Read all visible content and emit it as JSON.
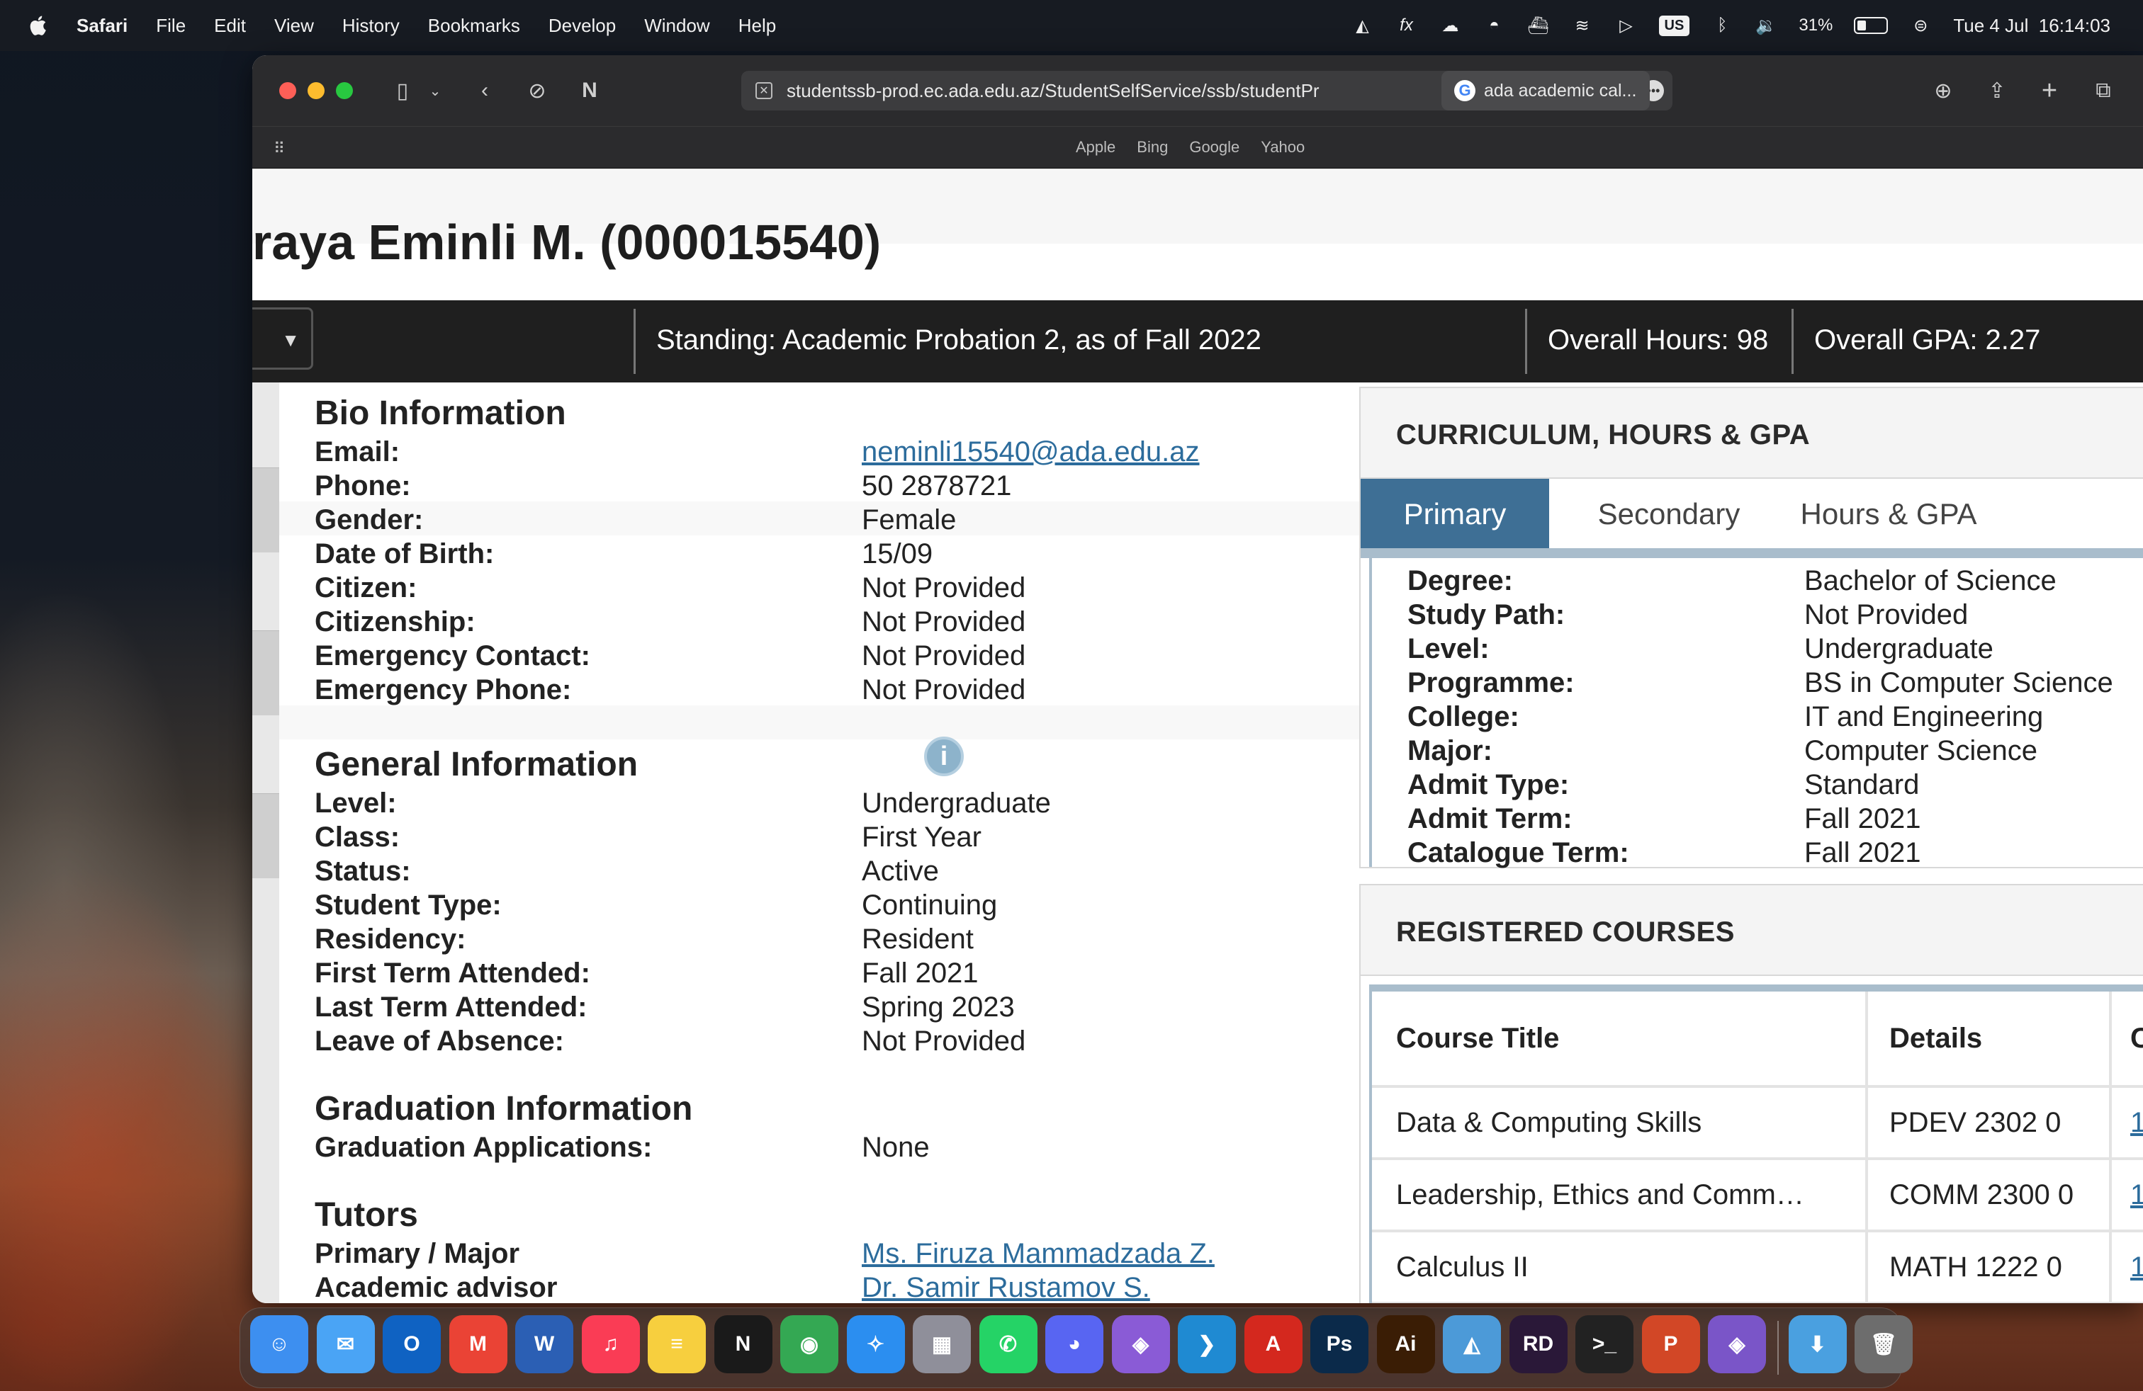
{
  "menubar": {
    "app_name": "Safari",
    "items": [
      "File",
      "Edit",
      "View",
      "History",
      "Bookmarks",
      "Develop",
      "Window",
      "Help"
    ],
    "battery_percent": "31%",
    "battery_level": 0.31,
    "input_source": "US",
    "clock": "Tue 4 Jul  16:14:03"
  },
  "browser": {
    "url": "studentssb-prod.ec.ada.edu.az/StudentSelfService/ssb/studentPr",
    "second_tab": "ada academic cal...",
    "favorites": [
      "Apple",
      "Bing",
      "Google",
      "Yahoo"
    ]
  },
  "profile": {
    "student_name": "raya Eminli M. (000015540)",
    "standing": "Standing: Academic Probation 2, as of Fall 2022",
    "overall_hours": "Overall Hours: 98",
    "overall_gpa": "Overall GPA: 2.27"
  },
  "bio": {
    "title": "Bio Information",
    "rows": [
      {
        "label": "Email:",
        "value": "neminli15540@ada.edu.az"
      },
      {
        "label": "Phone:",
        "value": "50 2878721"
      },
      {
        "label": "Gender:",
        "value": "Female"
      },
      {
        "label": "Date of Birth:",
        "value": "15/09"
      },
      {
        "label": "Citizen:",
        "value": "Not Provided"
      },
      {
        "label": "Citizenship:",
        "value": "Not Provided"
      },
      {
        "label": "Emergency Contact:",
        "value": "Not Provided"
      },
      {
        "label": "Emergency Phone:",
        "value": "Not Provided"
      }
    ]
  },
  "general": {
    "title": "General Information",
    "rows": [
      {
        "label": "Level:",
        "value": "Undergraduate"
      },
      {
        "label": "Class:",
        "value": "First Year"
      },
      {
        "label": "Status:",
        "value": "Active"
      },
      {
        "label": "Student Type:",
        "value": "Continuing"
      },
      {
        "label": "Residency:",
        "value": "Resident"
      },
      {
        "label": "First Term Attended:",
        "value": "Fall 2021"
      },
      {
        "label": "Last Term Attended:",
        "value": "Spring 2023"
      },
      {
        "label": "Leave of Absence:",
        "value": "Not Provided"
      }
    ]
  },
  "graduation": {
    "title": "Graduation Information",
    "rows": [
      {
        "label": "Graduation Applications:",
        "value": "None"
      }
    ]
  },
  "tutors": {
    "title": "Tutors",
    "rows": [
      {
        "label": "Primary / Major",
        "value": "Ms. Firuza Mammadzada Z."
      },
      {
        "label": "Academic advisor",
        "value": "Dr. Samir Rustamov S."
      }
    ]
  },
  "curriculum": {
    "title": "CURRICULUM, HOURS & GPA",
    "tabs": [
      "Primary",
      "Secondary",
      "Hours & GPA"
    ],
    "rows": [
      {
        "label": "Degree:",
        "value": "Bachelor of Science"
      },
      {
        "label": "Study Path:",
        "value": "Not Provided"
      },
      {
        "label": "Level:",
        "value": "Undergraduate"
      },
      {
        "label": "Programme:",
        "value": "BS in Computer Science"
      },
      {
        "label": "College:",
        "value": "IT and Engineering"
      },
      {
        "label": "Major:",
        "value": "Computer Science"
      },
      {
        "label": "Admit Type:",
        "value": "Standard"
      },
      {
        "label": "Admit Term:",
        "value": "Fall 2021"
      },
      {
        "label": "Catalogue Term:",
        "value": "Fall 2021"
      }
    ]
  },
  "courses": {
    "title": "REGISTERED COURSES",
    "headers": [
      "Course Title",
      "Details",
      "C"
    ],
    "rows": [
      {
        "title": "Data & Computing Skills",
        "details": "PDEV 2302 0",
        "c": "1("
      },
      {
        "title": "Leadership, Ethics and Comm…",
        "details": "COMM 2300 0",
        "c": "1("
      },
      {
        "title": "Calculus II",
        "details": "MATH 1222 0",
        "c": "1("
      }
    ]
  },
  "dock": {
    "apps": [
      {
        "name": "Finder",
        "glyph": "☺",
        "color": "#3d8ff0"
      },
      {
        "name": "Mail",
        "glyph": "✉",
        "color": "#4aa4f5"
      },
      {
        "name": "Outlook",
        "glyph": "O",
        "color": "#0f62c2"
      },
      {
        "name": "Gmail",
        "glyph": "M",
        "color": "#ea4335"
      },
      {
        "name": "Word",
        "glyph": "W",
        "color": "#2b5fb4"
      },
      {
        "name": "Music",
        "glyph": "♫",
        "color": "#fa3c55"
      },
      {
        "name": "Notes",
        "glyph": "≡",
        "color": "#f7cf3e"
      },
      {
        "name": "Netflix",
        "glyph": "N",
        "color": "#1a1a1a"
      },
      {
        "name": "Chrome",
        "glyph": "◉",
        "color": "#34a853"
      },
      {
        "name": "Safari",
        "glyph": "✧",
        "color": "#2b8ef0"
      },
      {
        "name": "Launchpad",
        "glyph": "▦",
        "color": "#8f8f9a"
      },
      {
        "name": "WhatsApp",
        "glyph": "✆",
        "color": "#25d366"
      },
      {
        "name": "Discord",
        "glyph": "◕",
        "color": "#5865f2"
      },
      {
        "name": "Visual Studio",
        "glyph": "◈",
        "color": "#8a5bd6"
      },
      {
        "name": "VS Code",
        "glyph": "❯",
        "color": "#1f8ad2"
      },
      {
        "name": "Acrobat",
        "glyph": "A",
        "color": "#d4281e"
      },
      {
        "name": "Photoshop",
        "glyph": "Ps",
        "color": "#0b2a4a"
      },
      {
        "name": "Illustrator",
        "glyph": "Ai",
        "color": "#3a1d05"
      },
      {
        "name": "Docker",
        "glyph": "◭",
        "color": "#4c9ad8"
      },
      {
        "name": "Rider",
        "glyph": "RD",
        "color": "#2a1838"
      },
      {
        "name": "Terminal",
        "glyph": ">_",
        "color": "#222222"
      },
      {
        "name": "PowerPoint",
        "glyph": "P",
        "color": "#d24726"
      },
      {
        "name": "Visual Studio Preview",
        "glyph": "◈",
        "color": "#7a55c8"
      },
      {
        "name": "Downloads",
        "glyph": "⬇",
        "color": "#4aa0e0"
      },
      {
        "name": "Trash",
        "glyph": "🗑",
        "color": "#6d6d6d"
      }
    ]
  }
}
